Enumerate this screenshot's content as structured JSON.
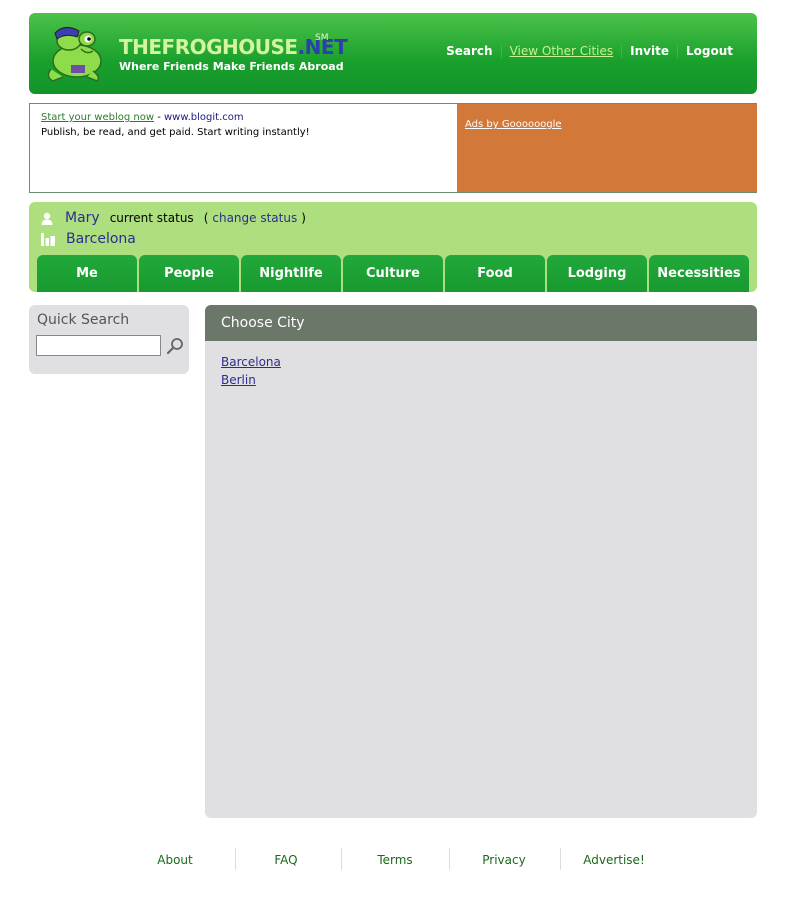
{
  "header": {
    "logo_title": "THEFROGHOUSE",
    "logo_net": ".NET",
    "logo_sm": "SM",
    "tagline": "Where Friends Make Friends Abroad",
    "nav": [
      "Search",
      "View Other Cities",
      "Invite",
      "Logout"
    ]
  },
  "ad": {
    "link_text": "Start your weblog now",
    "separator": "-",
    "url": "www.blogit.com",
    "body": "Publish, be read, and get paid. Start writing instantly!",
    "ads_by": "Ads by Goooooogle",
    "accent": "#d27838"
  },
  "status": {
    "user": "Mary",
    "label": "current status",
    "paren_open": "(",
    "change": "change status",
    "paren_close": ")",
    "city": "Barcelona"
  },
  "tabs": [
    "Me",
    "People",
    "Nightlife",
    "Culture",
    "Food",
    "Lodging",
    "Necessities"
  ],
  "sidebar": {
    "title": "Quick Search",
    "input_value": "",
    "icon": "search-icon"
  },
  "main": {
    "title": "Choose City",
    "cities": [
      "Barcelona",
      "Berlin"
    ]
  },
  "footer": [
    "About",
    "FAQ",
    "Terms",
    "Privacy",
    "Advertise!"
  ]
}
